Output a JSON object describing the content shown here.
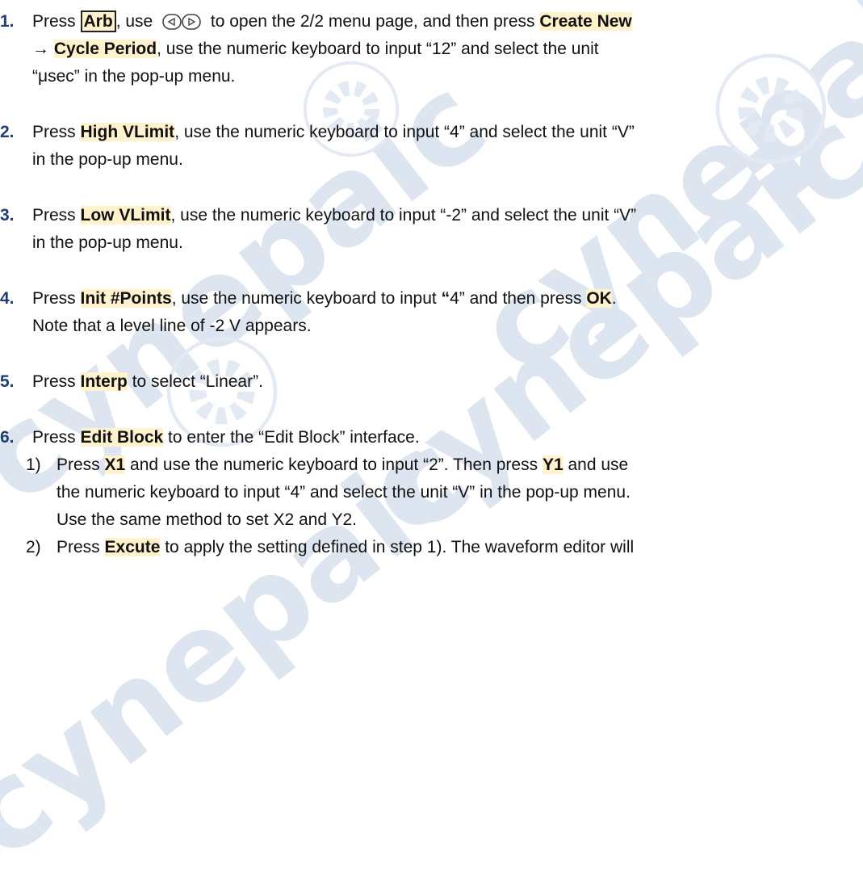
{
  "watermark": {
    "logo_text": [
      "cynepaic",
      "cynepaic",
      "cynepaic",
      "cynepaic"
    ]
  },
  "icons": {
    "arrow_keys": "direction-keys-icon",
    "watermark_gear": "gear-icon"
  },
  "colors": {
    "highlight": "#fff2cc",
    "watermark": "#dde5f1",
    "step_number": "#1f3f73"
  },
  "steps": [
    {
      "num": "1.",
      "line1_pre": "Press ",
      "key": "Arb",
      "line1_mid": ", use ",
      "line1_post": " to open the 2/2 menu page, and then press ",
      "key2": "Create New",
      "line2_pre": "→ ",
      "key3": "Cycle Period",
      "line2_post": ", use the numeric keyboard to input “12” and select the unit",
      "line3": "“μsec” in the pop-up menu."
    },
    {
      "num": "2.",
      "pre": "Press ",
      "key": "High VLimit",
      "post": ", use the numeric keyboard to input “4” and select the unit “V”",
      "line2": "in the pop-up menu."
    },
    {
      "num": "3.",
      "pre": "Press ",
      "key": "Low VLimit",
      "post": ", use the numeric keyboard to input “-2” and select the unit “V”",
      "line2": "in the pop-up menu."
    },
    {
      "num": "4.",
      "pre": "Press ",
      "key": "Init #Points",
      "post": ", use the numeric keyboard to input ",
      "quote": "“",
      "post2": "4” and then press ",
      "key2": "OK",
      "end": ".",
      "line2": "Note that a level line of -2 V appears."
    },
    {
      "num": "5.",
      "pre": "Press ",
      "key": "Interp",
      "post": " to select “Linear”."
    },
    {
      "num": "6.",
      "pre": "Press ",
      "key": "Edit Block",
      "post": " to enter the “Edit Block” interface.",
      "subs": [
        {
          "num": "1)",
          "pre": "Press ",
          "key": "X1",
          "mid": " and use the numeric keyboard to input “2”. Then press ",
          "key2": "Y1",
          "post": " and use",
          "line2": "the numeric keyboard to input “4” and select the unit “V” in the pop-up menu.",
          "line3": "Use the same method to set X2 and Y2."
        },
        {
          "num": "2)",
          "pre": "Press ",
          "key": "Excute",
          "post": " to apply the setting defined in step 1). The waveform editor will"
        }
      ]
    }
  ]
}
